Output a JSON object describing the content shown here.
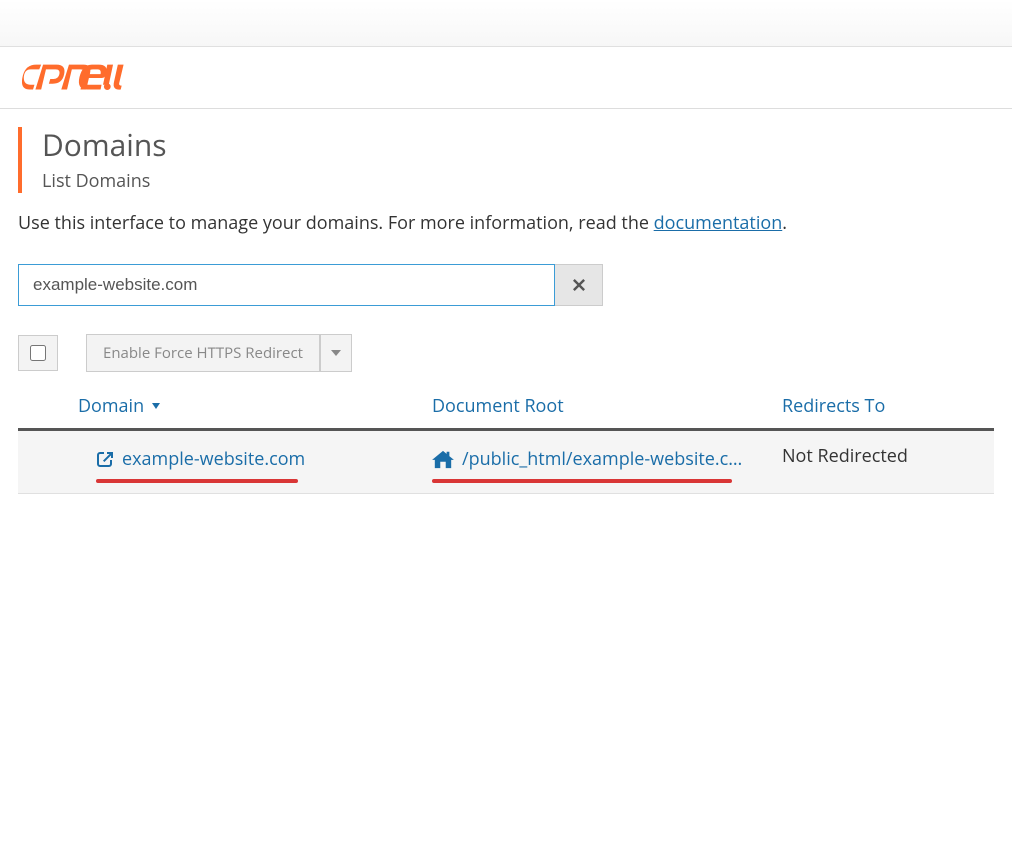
{
  "brand": "cPanel",
  "page": {
    "title": "Domains",
    "subtitle": "List Domains"
  },
  "description": {
    "text_before": "Use this interface to manage your domains. For more information, read the ",
    "link": "documentation",
    "text_after": "."
  },
  "search": {
    "value": "example-website.com",
    "clear_icon": "close-icon"
  },
  "actions": {
    "enable_https": "Enable Force HTTPS Redirect"
  },
  "table": {
    "headers": {
      "domain": "Domain",
      "docroot": "Document Root",
      "redirects": "Redirects To"
    },
    "rows": [
      {
        "domain": "example-website.com",
        "docroot": "/public_html/example-website.c…",
        "redirects": "Not Redirected"
      }
    ]
  }
}
